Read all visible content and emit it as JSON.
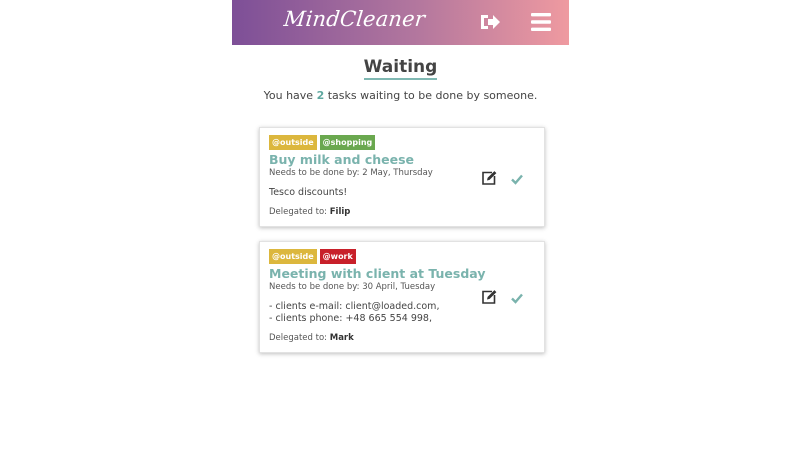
{
  "header": {
    "logo": "MindCleaner",
    "logout_icon": "sign-out-icon",
    "menu_icon": "hamburger-menu-icon",
    "gradient": [
      "#7d4f97",
      "#ef9aa0"
    ]
  },
  "page": {
    "title": "Waiting",
    "summary_prefix": "You have",
    "summary_count": "2",
    "summary_suffix": "tasks waiting to be done by someone."
  },
  "tasks": [
    {
      "tags": [
        {
          "label": "@outside",
          "color": "#dcb73d"
        },
        {
          "label": "@shopping",
          "color": "#6aa84f"
        }
      ],
      "title": "Buy milk and cheese",
      "due_label": "Needs to be done by:",
      "due_date": "2 May, Thursday",
      "description": [
        "Tesco discounts!"
      ],
      "delegated_label": "Delegated to:",
      "delegated_to": "Filip"
    },
    {
      "tags": [
        {
          "label": "@outside",
          "color": "#dcb73d"
        },
        {
          "label": "@work",
          "color": "#c8202a"
        }
      ],
      "title": "Meeting with client at Tuesday",
      "due_label": "Needs to be done by:",
      "due_date": "30 April, Tuesday",
      "description": [
        "- clients e-mail: client@loaded.com,",
        "- clients phone: +48 665 554 998,"
      ],
      "delegated_label": "Delegated to:",
      "delegated_to": "Mark"
    }
  ],
  "colors": {
    "accent": "#7ab3ad",
    "check": "#7ab3ad"
  }
}
